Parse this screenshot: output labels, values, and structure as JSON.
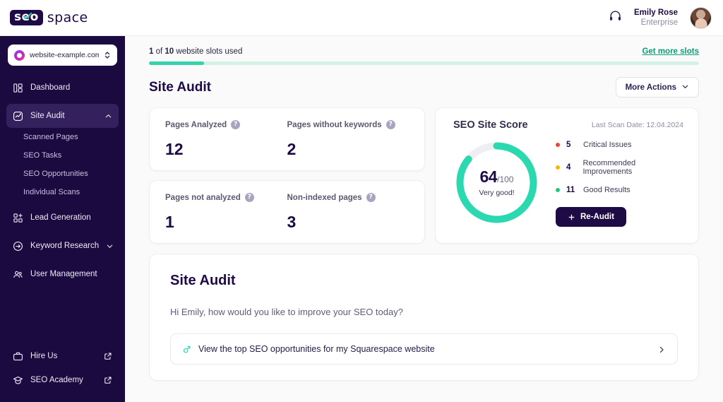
{
  "brand": {
    "badge_text": "seo",
    "word": "space",
    "accent": "#2BD9B0",
    "dark": "#1E0B46"
  },
  "topbar": {
    "support_icon": "headset-icon",
    "user": {
      "name": "Emily Rose",
      "plan": "Enterprise"
    }
  },
  "sidebar": {
    "site_selector": {
      "value": "website-example.com",
      "icon": "site-globe-icon",
      "caret": "up-down-icon"
    },
    "items": [
      {
        "label": "Dashboard",
        "icon": "dashboard-icon",
        "active": false,
        "expandable": false
      },
      {
        "label": "Site Audit",
        "icon": "site-audit-icon",
        "active": true,
        "expandable": true,
        "expanded": true
      },
      {
        "label": "Lead Generation",
        "icon": "lead-generation-icon",
        "active": false,
        "expandable": false
      },
      {
        "label": "Keyword Research",
        "icon": "keyword-research-icon",
        "active": false,
        "expandable": true,
        "expanded": false
      },
      {
        "label": "User Management",
        "icon": "user-management-icon",
        "active": false,
        "expandable": false
      }
    ],
    "site_audit_children": [
      {
        "label": "Scanned Pages"
      },
      {
        "label": "SEO Tasks"
      },
      {
        "label": "SEO Opportunities"
      },
      {
        "label": "Individual Scans"
      }
    ],
    "bottom_items": [
      {
        "label": "Hire Us",
        "icon": "briefcase-icon",
        "external": true
      },
      {
        "label": "SEO Academy",
        "icon": "graduation-cap-icon",
        "external": true
      }
    ]
  },
  "slots": {
    "used": 1,
    "total": 10,
    "text_prefix": "1",
    "text_middle": " of ",
    "text_total": "10",
    "text_suffix": " website slots used",
    "link_label": "Get more slots",
    "percent": 10,
    "fill_color": "#34D3AD",
    "track_color": "#D2F2E6"
  },
  "header": {
    "page_title": "Site Audit",
    "more_actions_label": "More Actions",
    "more_actions_icon": "chevron-down-icon"
  },
  "stats": [
    {
      "label": "Pages Analyzed",
      "value": "12",
      "help": "help-icon"
    },
    {
      "label": "Pages without keywords",
      "value": "2",
      "help": "help-icon"
    },
    {
      "label": "Pages not analyzed",
      "value": "1",
      "help": "help-icon"
    },
    {
      "label": "Non-indexed pages",
      "value": "3",
      "help": "help-icon"
    }
  ],
  "score_card": {
    "title": "SEO Site Score",
    "last_scan_label": "Last Scan Date: 12.04.2024",
    "reaudit_label": "Re-Audit",
    "reaudit_icon": "plus-icon",
    "legend": [
      {
        "count": "5",
        "label": "Critical Issues",
        "color": "#F04438"
      },
      {
        "count": "4",
        "label": "Recommended Improvements",
        "color": "#F5B700"
      },
      {
        "count": "11",
        "label": "Good Results",
        "color": "#22C77E"
      }
    ]
  },
  "chart_data": {
    "type": "pie",
    "title": "SEO Site Score",
    "subtype": "donut-gauge",
    "score": 64,
    "max": 100,
    "score_display": "64",
    "denominator_display": "/100",
    "caption": "Very good!",
    "arc_percent": 86,
    "arc_color": "#2BD9B0",
    "track_color": "#EFEFF3",
    "categories": [
      "Critical Issues",
      "Recommended Improvements",
      "Good Results"
    ],
    "values": [
      5,
      4,
      11
    ],
    "colors": [
      "#F04438",
      "#F5B700",
      "#22C77E"
    ],
    "legend_position": "right",
    "grid": false
  },
  "audit_panel": {
    "title": "Site Audit",
    "greeting": "Hi Emily, how would you like to improve your SEO today?",
    "opportunity": {
      "icon": "rocket-icon",
      "text": "View the top SEO opportunities for my Squarespace website",
      "chevron": "chevron-right-icon"
    }
  }
}
